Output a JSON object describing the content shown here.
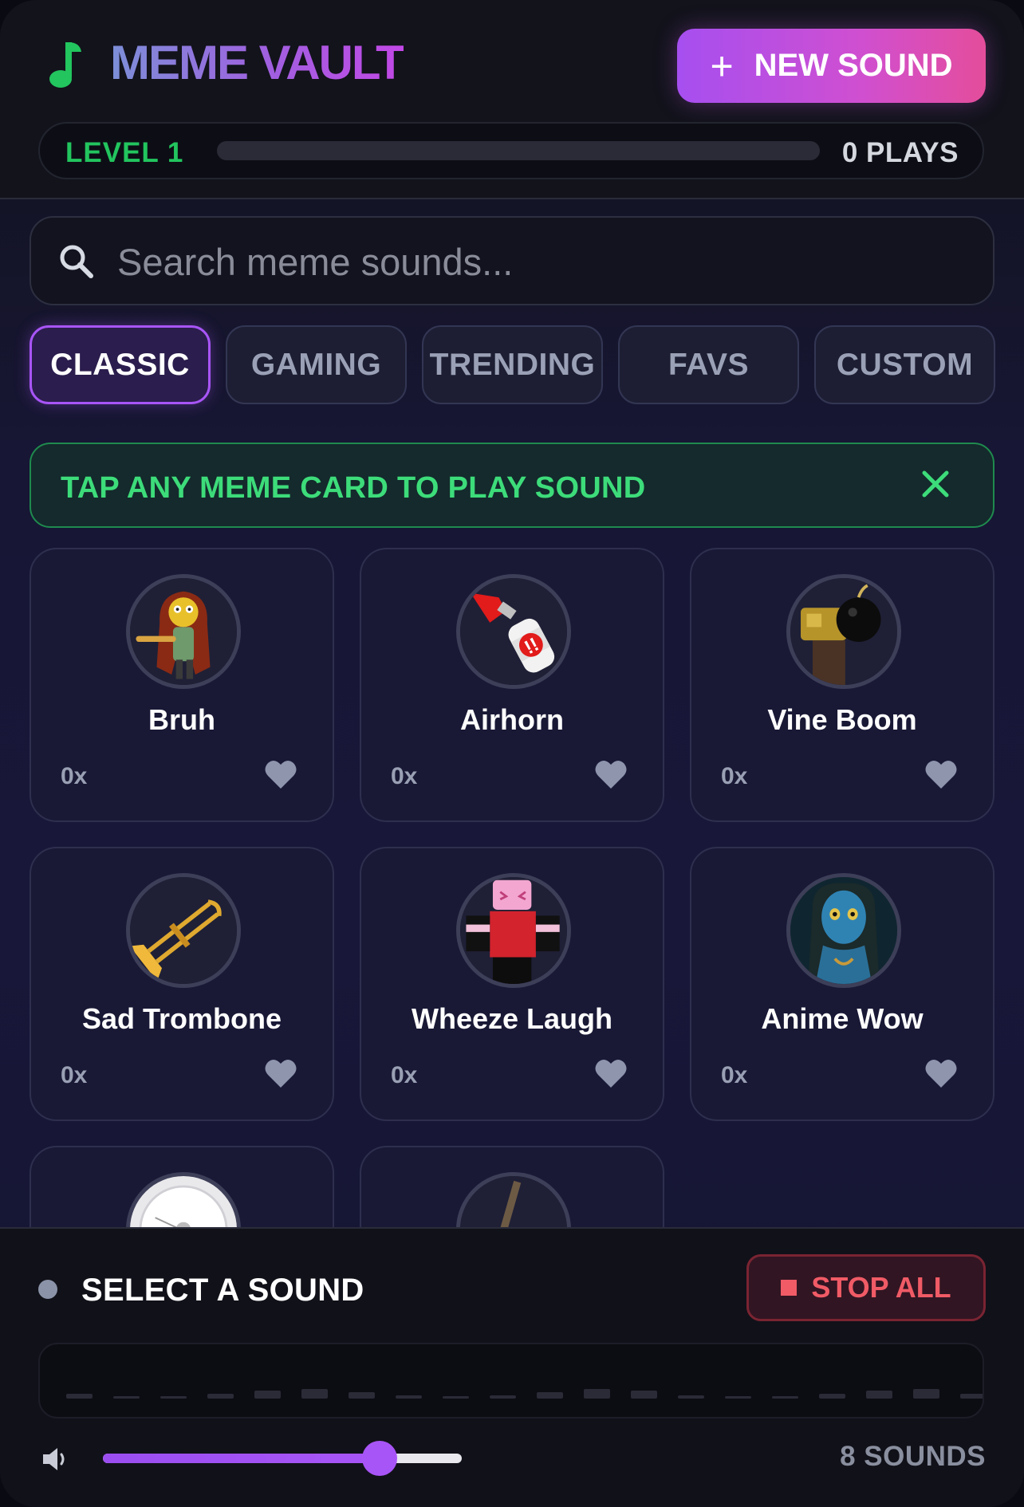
{
  "app": {
    "title": "MEME VAULT",
    "new_sound_label": "NEW SOUND",
    "accent_color": "#a855f7",
    "brand_icon": "music-note-icon"
  },
  "progress": {
    "level_label": "LEVEL 1",
    "plays_label": "0 PLAYS",
    "fill_fraction": 0
  },
  "search": {
    "placeholder": "Search meme sounds...",
    "value": ""
  },
  "tabs": [
    {
      "label": "CLASSIC",
      "active": true
    },
    {
      "label": "GAMING",
      "active": false
    },
    {
      "label": "TRENDING",
      "active": false
    },
    {
      "label": "FAVS",
      "active": false
    },
    {
      "label": "CUSTOM",
      "active": false
    }
  ],
  "notice": {
    "text": "TAP ANY MEME CARD TO PLAY SOUND"
  },
  "sounds": [
    {
      "name": "Bruh",
      "count": "0x",
      "icon": "bruh-character-icon"
    },
    {
      "name": "Airhorn",
      "count": "0x",
      "icon": "airhorn-icon"
    },
    {
      "name": "Vine Boom",
      "count": "0x",
      "icon": "vine-boom-icon"
    },
    {
      "name": "Sad Trombone",
      "count": "0x",
      "icon": "trombone-icon"
    },
    {
      "name": "Wheeze Laugh",
      "count": "0x",
      "icon": "wheeze-laugh-icon"
    },
    {
      "name": "Anime Wow",
      "count": "0x",
      "icon": "anime-wow-icon"
    },
    {
      "name": "",
      "count": "",
      "icon": "clock-icon"
    },
    {
      "name": "",
      "count": "",
      "icon": "stick-icon"
    }
  ],
  "player": {
    "status": "SELECT A SOUND",
    "stop_label": "STOP ALL",
    "volume": 0.77,
    "sounds_count": "8 SOUNDS"
  }
}
